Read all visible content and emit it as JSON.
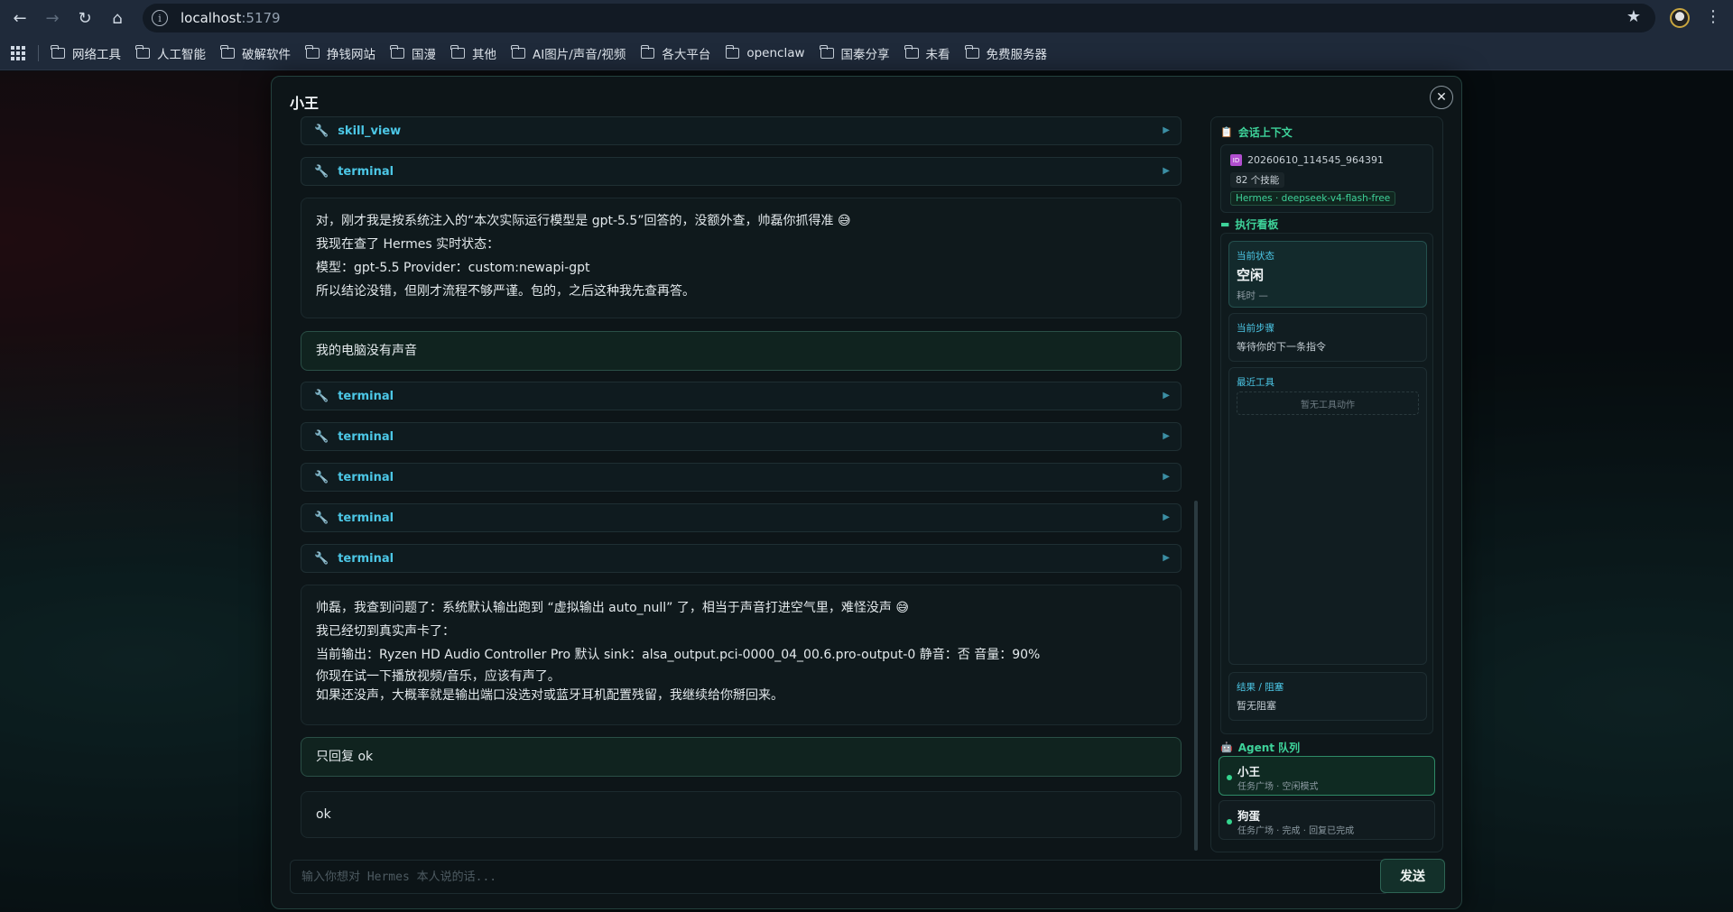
{
  "browser": {
    "url_host": "localhost",
    "url_port": ":5179",
    "bookmarks": [
      "网络工具",
      "人工智能",
      "破解软件",
      "挣钱网站",
      "国漫",
      "其他",
      "AI图片/声音/视频",
      "各大平台",
      "openclaw",
      "国秦分享",
      "未看",
      "免费服务器"
    ]
  },
  "modal": {
    "title": "小王",
    "close_glyph": "✕"
  },
  "chat": {
    "tool_arrow": "▶",
    "wrench": "🔧",
    "tool_calls_top": [
      "skill_view",
      "terminal"
    ],
    "reply1": [
      "对，刚才我是按系统注入的“本次实际运行模型是 gpt-5.5”回答的，没额外查，帅磊你抓得准 😅",
      "我现在查了 Hermes 实时状态：",
      "模型：gpt-5.5 Provider：custom:newapi-gpt",
      "所以结论没错，但刚才流程不够严谨。包的，之后这种我先查再答。"
    ],
    "user1": "我的电脑没有声音",
    "tool_calls_mid": [
      "terminal",
      "terminal",
      "terminal",
      "terminal",
      "terminal"
    ],
    "reply2": [
      "帅磊，我查到问题了：系统默认输出跑到 “虚拟输出 auto_null” 了，相当于声音打进空气里，难怪没声 😅",
      "我已经切到真实声卡了：",
      "当前输出：Ryzen HD Audio Controller Pro 默认 sink：alsa_output.pci-0000_04_00.6.pro-output-0 静音：否 音量：90%",
      "你现在试一下播放视频/音乐，应该有声了。",
      "如果还没声，大概率就是输出端口没选对或蓝牙耳机配置残留，我继续给你掰回来。"
    ],
    "user2": "只回复 ok",
    "reply3": "ok"
  },
  "side": {
    "context_heading": "会话上下文",
    "context_icon": "📋",
    "session_badge": "ID",
    "session_id": "20260610_114545_964391",
    "skills": "82 个技能",
    "model": "Hermes · deepseek-v4-flash-free",
    "board_heading": "执行看板",
    "board_icon": "▬",
    "status_label": "当前状态",
    "status_value": "空闲",
    "status_time": "耗时 —",
    "step_label": "当前步骤",
    "step_value": "等待你的下一条指令",
    "tools_label": "最近工具",
    "tools_empty": "暂无工具动作",
    "result_label": "结果 / 阻塞",
    "result_value": "暂无阻塞",
    "agents_heading": "Agent 队列",
    "agents_icon": "🤖",
    "agents": [
      {
        "name": "小王",
        "desc": "任务广场 · 空闲模式"
      },
      {
        "name": "狗蛋",
        "desc": "任务广场 · 完成 · 回复已完成"
      }
    ]
  },
  "input": {
    "placeholder": "输入你想对 Hermes 本人说的话...",
    "send_label": "发送"
  },
  "colors": {
    "accent": "#3ed39a",
    "tool": "#4cc7e6"
  }
}
